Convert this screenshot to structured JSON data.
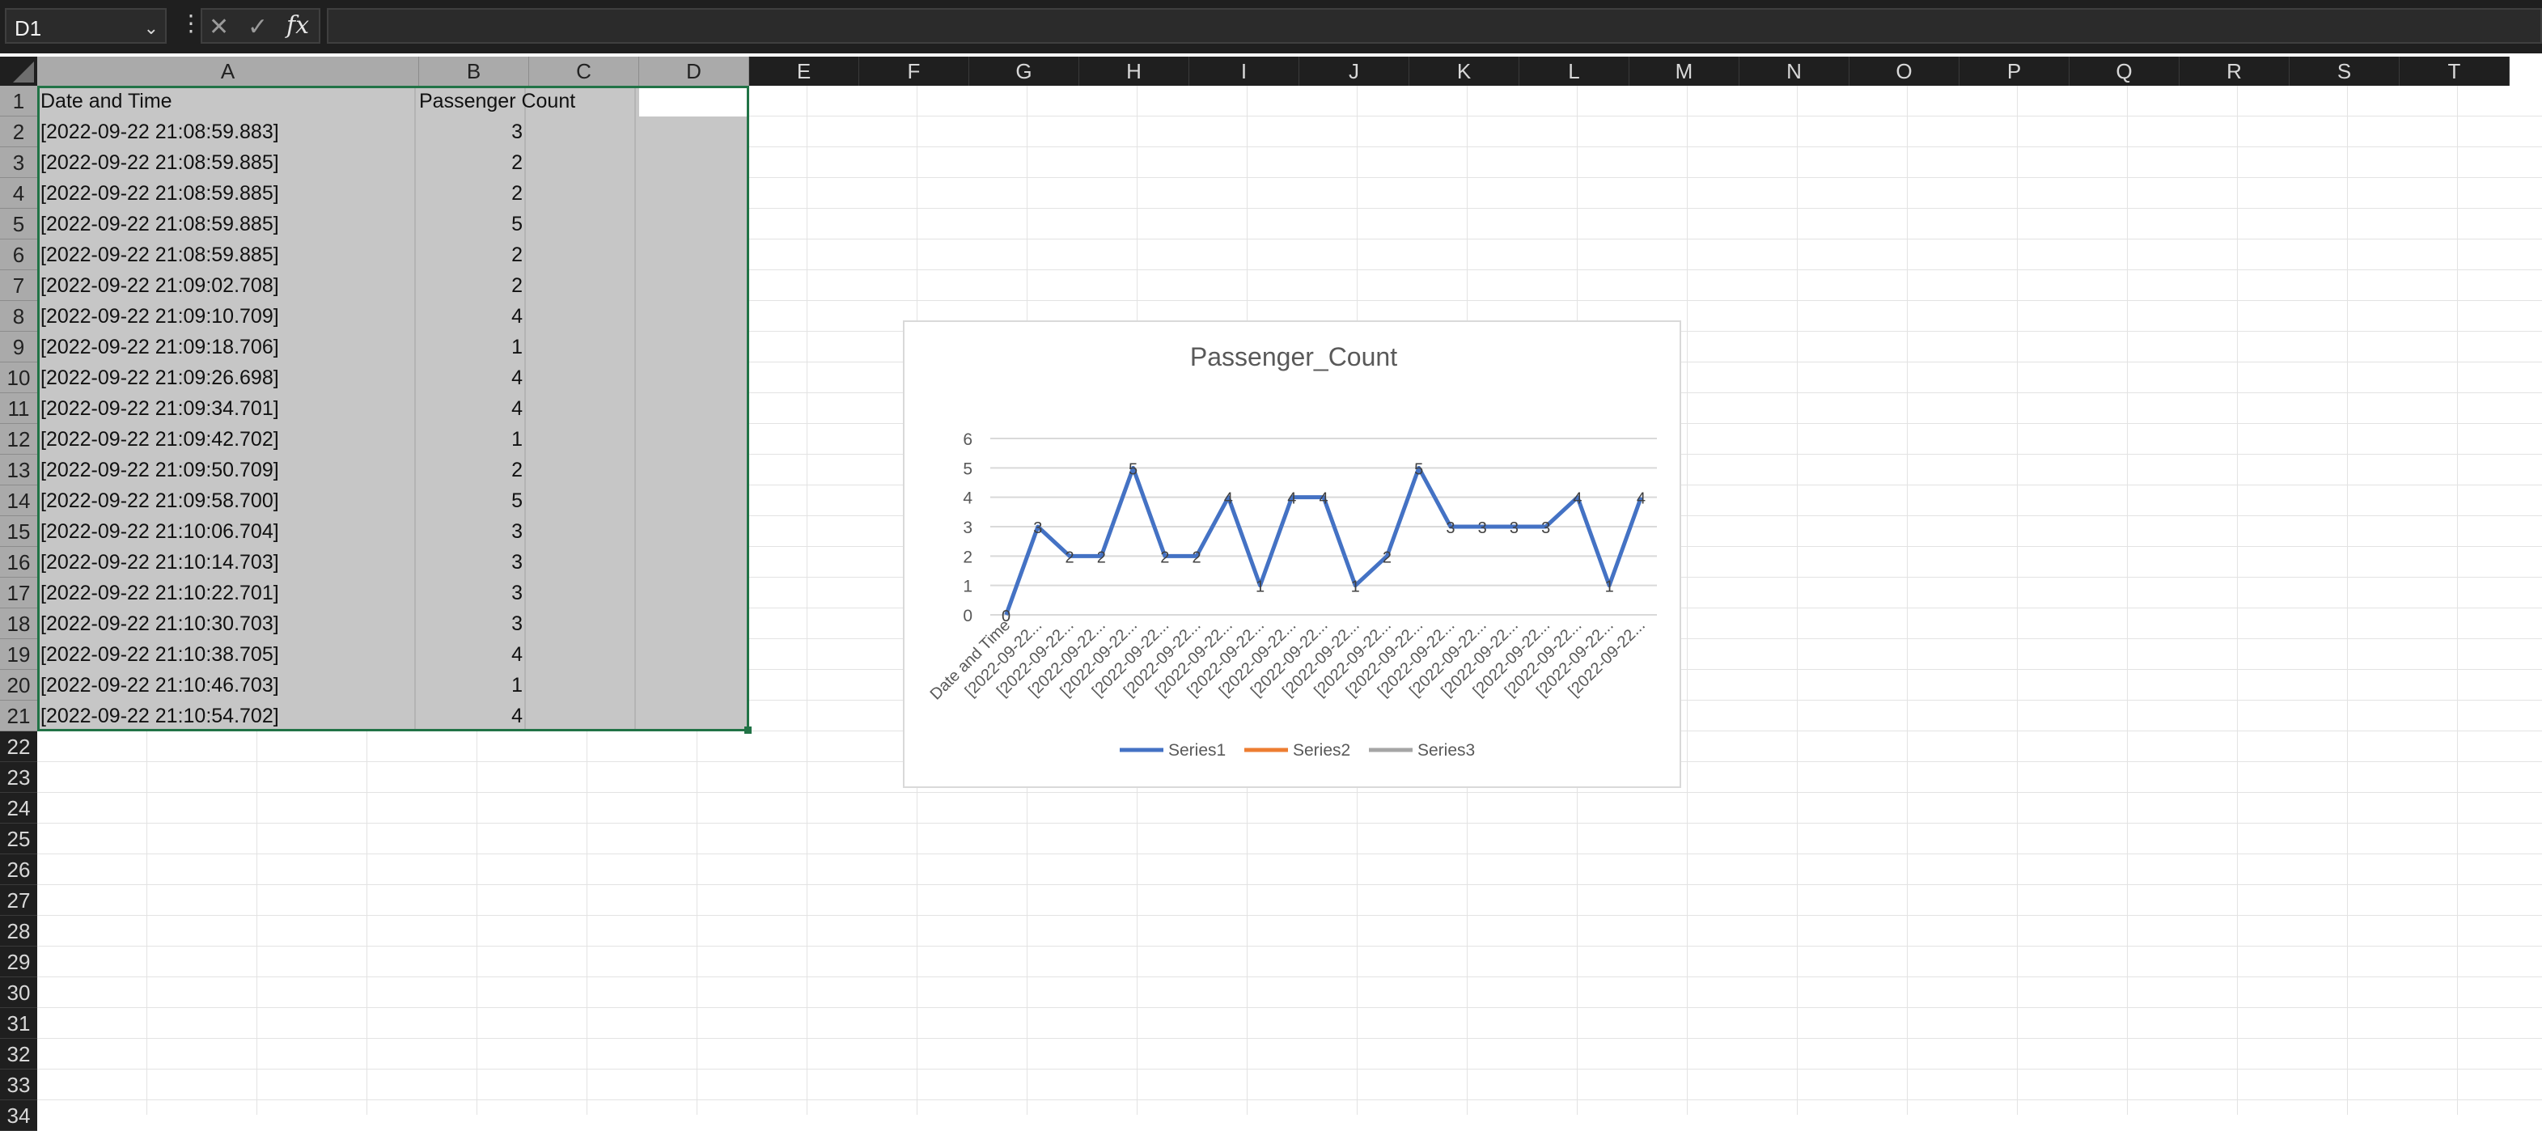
{
  "formula_bar": {
    "name_box": "D1",
    "cancel_icon": "✕",
    "enter_icon": "✓",
    "fx_label": "fx",
    "formula_value": ""
  },
  "columns": [
    "A",
    "B",
    "C",
    "D",
    "E",
    "F",
    "G",
    "H",
    "I",
    "J",
    "K",
    "L",
    "M",
    "N",
    "O",
    "P",
    "Q",
    "R",
    "S",
    "T"
  ],
  "rows": [
    "1",
    "2",
    "3",
    "4",
    "5",
    "6",
    "7",
    "8",
    "9",
    "10",
    "11",
    "12",
    "13",
    "14",
    "15",
    "16",
    "17",
    "18",
    "19",
    "20",
    "21",
    "22",
    "23",
    "24",
    "25",
    "26",
    "27",
    "28",
    "29",
    "30",
    "31",
    "32",
    "33",
    "34"
  ],
  "sheet": {
    "header_a": "Date and Time",
    "header_b": "Passenger Count",
    "data": [
      {
        "a": "[2022-09-22 21:08:59.883]",
        "b": "3"
      },
      {
        "a": "[2022-09-22 21:08:59.885]",
        "b": "2"
      },
      {
        "a": "[2022-09-22 21:08:59.885]",
        "b": "2"
      },
      {
        "a": "[2022-09-22 21:08:59.885]",
        "b": "5"
      },
      {
        "a": "[2022-09-22 21:08:59.885]",
        "b": "2"
      },
      {
        "a": "[2022-09-22 21:09:02.708]",
        "b": "2"
      },
      {
        "a": "[2022-09-22 21:09:10.709]",
        "b": "4"
      },
      {
        "a": "[2022-09-22 21:09:18.706]",
        "b": "1"
      },
      {
        "a": "[2022-09-22 21:09:26.698]",
        "b": "4"
      },
      {
        "a": "[2022-09-22 21:09:34.701]",
        "b": "4"
      },
      {
        "a": "[2022-09-22 21:09:42.702]",
        "b": "1"
      },
      {
        "a": "[2022-09-22 21:09:50.709]",
        "b": "2"
      },
      {
        "a": "[2022-09-22 21:09:58.700]",
        "b": "5"
      },
      {
        "a": "[2022-09-22 21:10:06.704]",
        "b": "3"
      },
      {
        "a": "[2022-09-22 21:10:14.703]",
        "b": "3"
      },
      {
        "a": "[2022-09-22 21:10:22.701]",
        "b": "3"
      },
      {
        "a": "[2022-09-22 21:10:30.703]",
        "b": "3"
      },
      {
        "a": "[2022-09-22 21:10:38.705]",
        "b": "4"
      },
      {
        "a": "[2022-09-22 21:10:46.703]",
        "b": "1"
      },
      {
        "a": "[2022-09-22 21:10:54.702]",
        "b": "4"
      }
    ]
  },
  "colors": {
    "series1": "#4472c4",
    "series2": "#ed7d31",
    "series3": "#a5a5a5",
    "selection_border": "#217346"
  },
  "chart_data": {
    "type": "line",
    "title": "Passenger_Count",
    "categories": [
      "Date and Time",
      "[2022-09-22...",
      "[2022-09-22...",
      "[2022-09-22...",
      "[2022-09-22...",
      "[2022-09-22...",
      "[2022-09-22...",
      "[2022-09-22...",
      "[2022-09-22...",
      "[2022-09-22...",
      "[2022-09-22...",
      "[2022-09-22...",
      "[2022-09-22...",
      "[2022-09-22...",
      "[2022-09-22...",
      "[2022-09-22...",
      "[2022-09-22...",
      "[2022-09-22...",
      "[2022-09-22...",
      "[2022-09-22...",
      "[2022-09-22..."
    ],
    "series": [
      {
        "name": "Series1",
        "values": [
          0,
          3,
          2,
          2,
          5,
          2,
          2,
          4,
          1,
          4,
          4,
          1,
          2,
          5,
          3,
          3,
          3,
          3,
          4,
          1,
          4
        ]
      },
      {
        "name": "Series2",
        "values": []
      },
      {
        "name": "Series3",
        "values": []
      }
    ],
    "yticks": [
      0,
      1,
      2,
      3,
      4,
      5,
      6
    ],
    "ylim": [
      0,
      6
    ],
    "data_labels": true,
    "grid": true,
    "legend": "bottom"
  }
}
